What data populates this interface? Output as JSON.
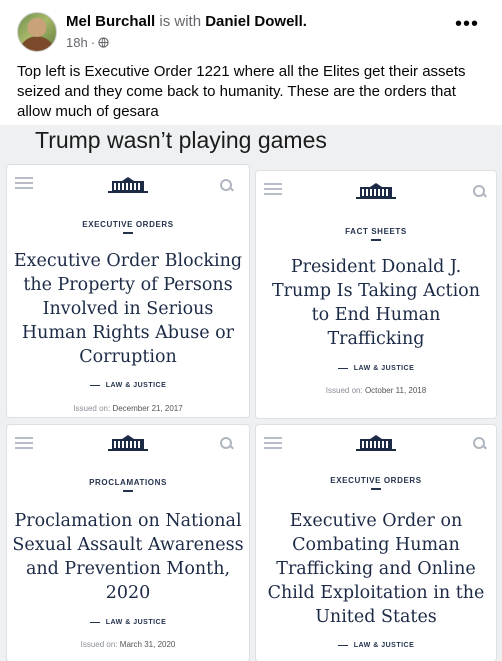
{
  "post": {
    "author": "Mel Burchall",
    "with_text": "is with",
    "tagged": "Daniel Dowell.",
    "time": "18h",
    "dot": "·",
    "caption": "Top left is Executive Order 1221 where all the Elites get their assets seized and they come back to humanity. These are the orders that allow much of gesara"
  },
  "image": {
    "headline": "Trump wasn’t playing games",
    "cards": [
      {
        "kicker": "EXECUTIVE ORDERS",
        "title": "Executive Order Blocking the Property of Persons Involved in Serious Human Rights Abuse or Corruption",
        "tag": "LAW & JUSTICE",
        "issued_label": "Issued on:",
        "issued_date": "December 21, 2017"
      },
      {
        "kicker": "FACT SHEETS",
        "title": "President Donald J. Trump Is Taking Action to End Human Trafficking",
        "tag": "LAW & JUSTICE",
        "issued_label": "Issued on:",
        "issued_date": "October 11, 2018"
      },
      {
        "kicker": "PROCLAMATIONS",
        "title": "Proclamation on National Sexual Assault Awareness and Prevention Month, 2020",
        "tag": "LAW & JUSTICE",
        "issued_label": "Issued on:",
        "issued_date": "March 31, 2020"
      },
      {
        "kicker": "EXECUTIVE ORDERS",
        "title": "Executive Order on Combating Human Trafficking and Online Child Exploitation in the United States",
        "tag": "LAW & JUSTICE",
        "issued_label": "",
        "issued_date": ""
      }
    ]
  },
  "icons": [
    "globe-icon",
    "more-options-icon",
    "menu-icon",
    "search-icon",
    "white-house-logo"
  ]
}
